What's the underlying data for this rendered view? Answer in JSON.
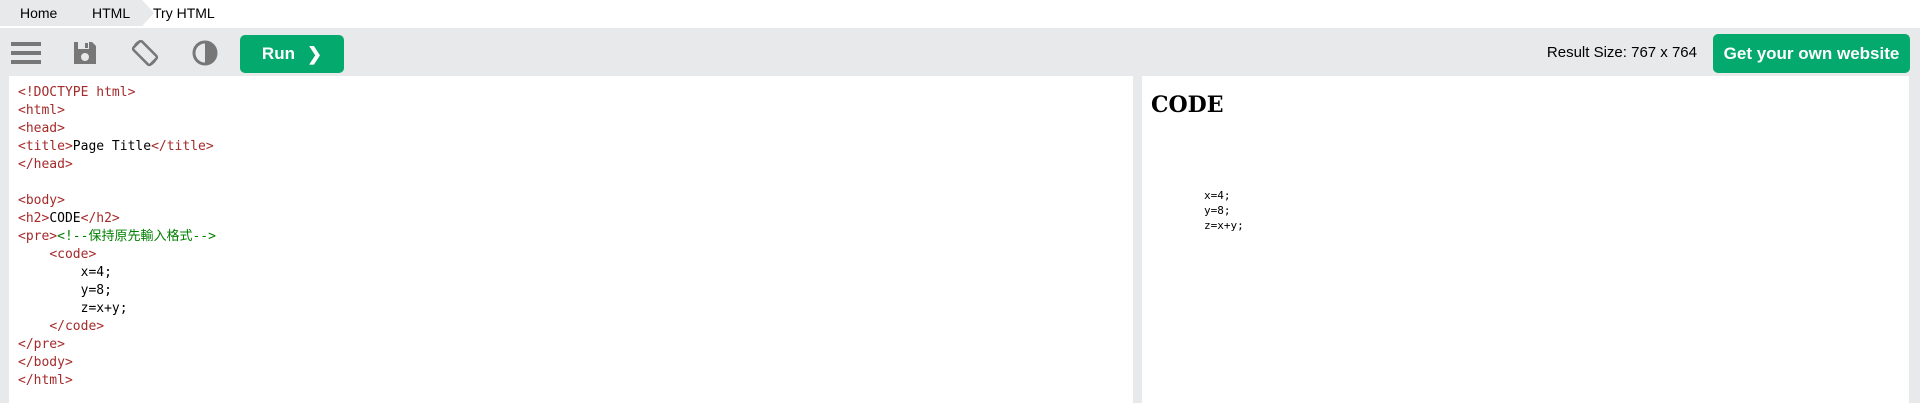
{
  "breadcrumb": [
    "Home",
    "HTML",
    "Try HTML"
  ],
  "toolbar": {
    "menu_icon": "menu-icon",
    "save_icon": "save-icon",
    "rotate_icon": "rotate-icon",
    "theme_icon": "contrast-icon",
    "run_label": "Run",
    "result_size": "Result Size: 767 x 764",
    "own_website_label": "Get your own website"
  },
  "editor": {
    "lines": [
      [
        {
          "k": "t",
          "v": "<!DOCTYPE html>"
        }
      ],
      [
        {
          "k": "t",
          "v": "<html>"
        }
      ],
      [
        {
          "k": "t",
          "v": "<head>"
        }
      ],
      [
        {
          "k": "t",
          "v": "<title>"
        },
        {
          "k": "n",
          "v": "Page Title"
        },
        {
          "k": "t",
          "v": "</title>"
        }
      ],
      [
        {
          "k": "t",
          "v": "</head>"
        }
      ],
      [],
      [
        {
          "k": "t",
          "v": "<body>"
        }
      ],
      [
        {
          "k": "t",
          "v": "<h2>"
        },
        {
          "k": "n",
          "v": "CODE"
        },
        {
          "k": "t",
          "v": "</h2>"
        }
      ],
      [
        {
          "k": "t",
          "v": "<pre>"
        },
        {
          "k": "c",
          "v": "<!--保持原先輸入格式-->"
        }
      ],
      [
        {
          "k": "n",
          "v": "    "
        },
        {
          "k": "t",
          "v": "<code>"
        }
      ],
      [
        {
          "k": "n",
          "v": "        x=4;"
        }
      ],
      [
        {
          "k": "n",
          "v": "        y=8;"
        }
      ],
      [
        {
          "k": "n",
          "v": "        z=x+y;"
        }
      ],
      [
        {
          "k": "n",
          "v": "    "
        },
        {
          "k": "t",
          "v": "</code>"
        }
      ],
      [
        {
          "k": "t",
          "v": "</pre>"
        }
      ],
      [
        {
          "k": "t",
          "v": "</body>"
        }
      ],
      [
        {
          "k": "t",
          "v": "</html>"
        }
      ]
    ]
  },
  "result": {
    "heading": "CODE",
    "code": "\n        x=4;\n        y=8;\n        z=x+y;\n    "
  }
}
